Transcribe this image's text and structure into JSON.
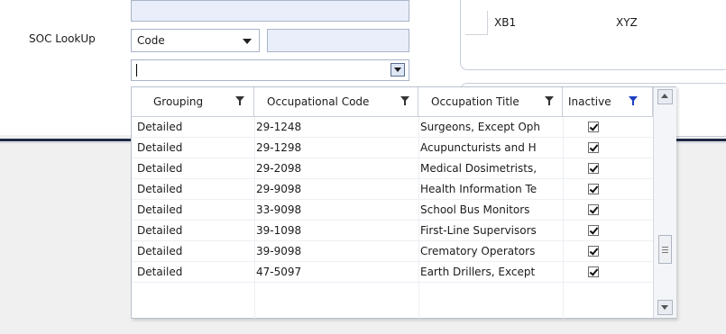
{
  "form": {
    "soc_label": "SOC LookUp",
    "code_combo": "Code"
  },
  "right_panel": {
    "item1": "XB1",
    "item2": "XYZ"
  },
  "grid": {
    "headers": [
      "Grouping",
      "Occupational Code",
      "Occupation Title",
      "Inactive"
    ],
    "rows": [
      {
        "grouping": "Detailed",
        "code": "29-1248",
        "title": "Surgeons, Except Oph",
        "inactive": true
      },
      {
        "grouping": "Detailed",
        "code": "29-1298",
        "title": "Acupuncturists and H",
        "inactive": true
      },
      {
        "grouping": "Detailed",
        "code": "29-2098",
        "title": "Medical Dosimetrists,",
        "inactive": true
      },
      {
        "grouping": "Detailed",
        "code": "29-9098",
        "title": "Health Information Te",
        "inactive": true
      },
      {
        "grouping": "Detailed",
        "code": "33-9098",
        "title": "School Bus Monitors",
        "inactive": true
      },
      {
        "grouping": "Detailed",
        "code": "39-1098",
        "title": "First-Line Supervisors",
        "inactive": true
      },
      {
        "grouping": "Detailed",
        "code": "39-9098",
        "title": "Crematory Operators",
        "inactive": true
      },
      {
        "grouping": "Detailed",
        "code": "47-5097",
        "title": "Earth Drillers, Except",
        "inactive": true
      }
    ]
  },
  "icons": {
    "filter": "filter-funnel-icon",
    "filter_active_color": "#1c3fc4",
    "dropdown": "chevron-down-icon",
    "check": "checkmark-icon"
  }
}
